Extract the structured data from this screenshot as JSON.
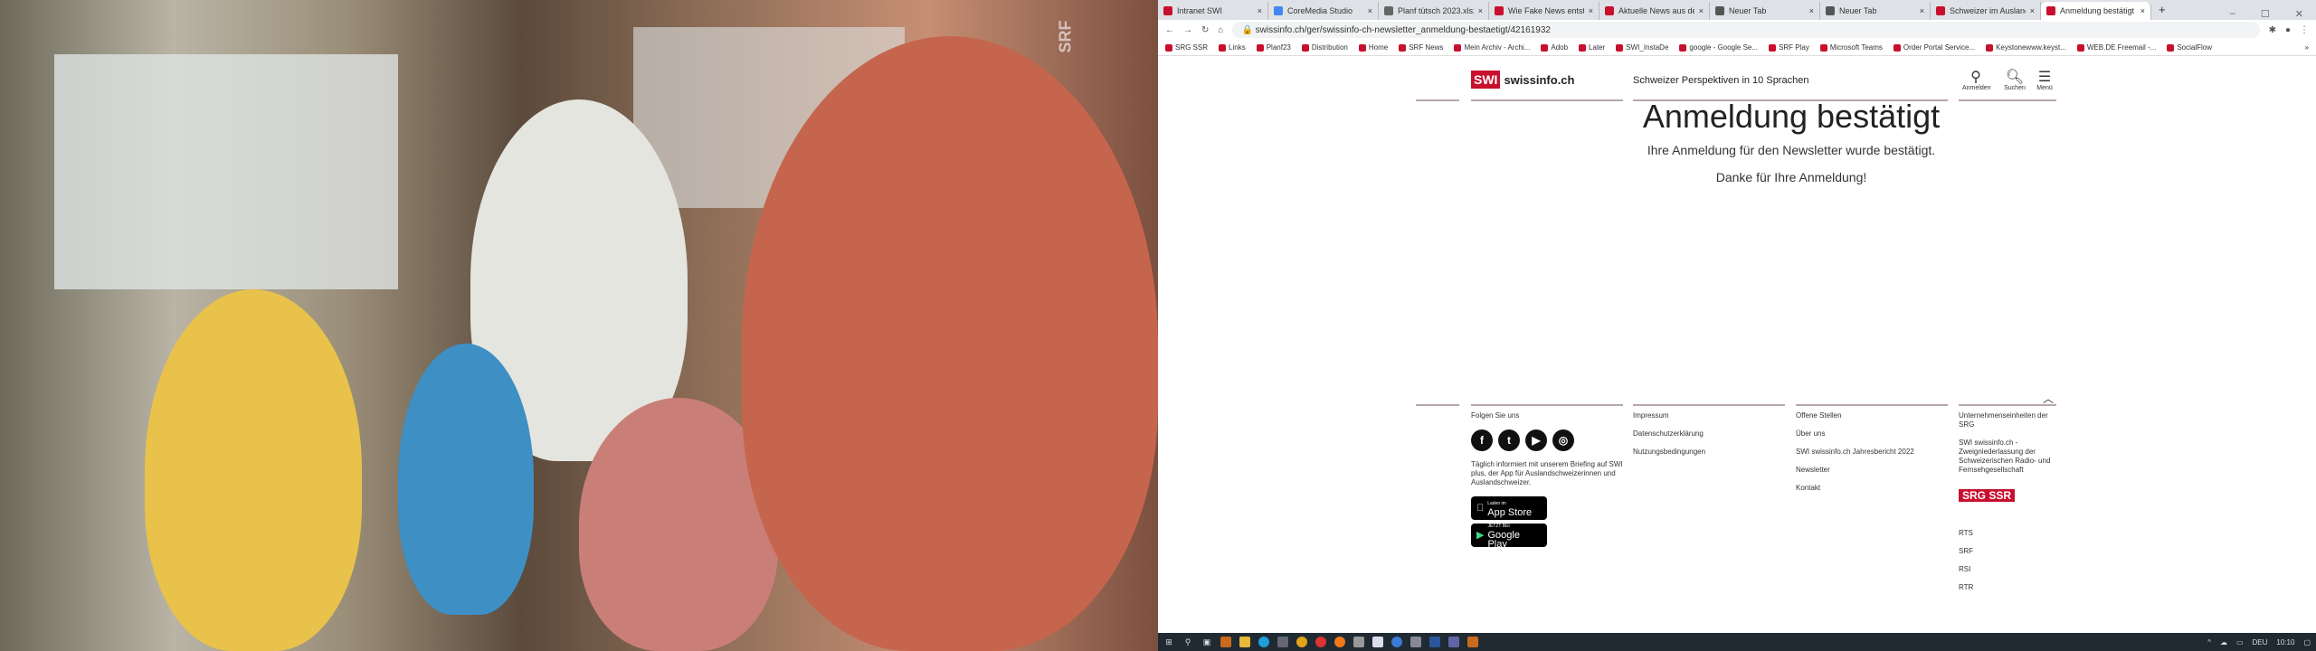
{
  "photo": {
    "watermark": "SRF"
  },
  "browser": {
    "tabs": [
      {
        "label": "Intranet SWI"
      },
      {
        "label": "CoreMedia Studio"
      },
      {
        "label": "Planf tütsch 2023.xlsx"
      },
      {
        "label": "Wie Fake News entst"
      },
      {
        "label": "Aktuelle News aus de"
      },
      {
        "label": "Neuer Tab"
      },
      {
        "label": "Neuer Tab"
      },
      {
        "label": "Schweizer im Ausland"
      },
      {
        "label": "Anmeldung bestätigt"
      }
    ],
    "new_tab": "+",
    "url": "swissinfo.ch/ger/swissinfo-ch-newsletter_anmeldung-bestaetigt/42161932",
    "bookmarks": [
      "SRG SSR",
      "Links",
      "Planf23",
      "Distribution",
      "Home",
      "SRF News",
      "Mein Archiv - Archi...",
      "Adob",
      "Later",
      "SWI_InstaDe",
      "google - Google Se...",
      "SRF Play",
      "Microsoft Teams",
      "Order Portal Service...",
      "Keystonewww.keyst...",
      "WEB.DE Freemail -...",
      "SocialFlow"
    ],
    "more_bookmarks": "»"
  },
  "header": {
    "logo_badge": "SWI",
    "logo_text": "swissinfo.ch",
    "tagline": "Schweizer Perspektiven in 10 Sprachen",
    "login": "Anmelden",
    "search": "Suchen",
    "menu": "Menü"
  },
  "main": {
    "title": "Anmeldung bestätigt",
    "message": "Ihre Anmeldung für den Newsletter wurde bestätigt.",
    "thanks": "Danke für Ihre Anmeldung!"
  },
  "footer": {
    "follow": "Folgen Sie uns",
    "briefing": "Täglich informiert mit unserem Briefing auf SWI plus, der App für Auslandschweizerinnen und Auslandschweizer.",
    "appstore_small": "Laden im",
    "appstore": "App Store",
    "googleplay_small": "JETZT BEI",
    "googleplay": "Google Play",
    "col2": [
      "Impressum",
      "Datenschutzerklärung",
      "Nutzungsbedingungen"
    ],
    "col3": [
      "Offene Stellen",
      "Über uns",
      "SWI swissinfo.ch Jahresbericht 2022",
      "Newsletter",
      "Kontakt"
    ],
    "units_title": "Unternehmenseinheiten der SRG",
    "branch": "SWI swissinfo.ch - Zweigniederlassung der Schweizerischen Radio- und Fernsehgesellschaft",
    "srg_logo": "SRG SSR",
    "units": [
      "RTS",
      "SRF",
      "RSI",
      "RTR"
    ]
  },
  "taskbar": {
    "lang": "DEU",
    "time": "10:10"
  }
}
